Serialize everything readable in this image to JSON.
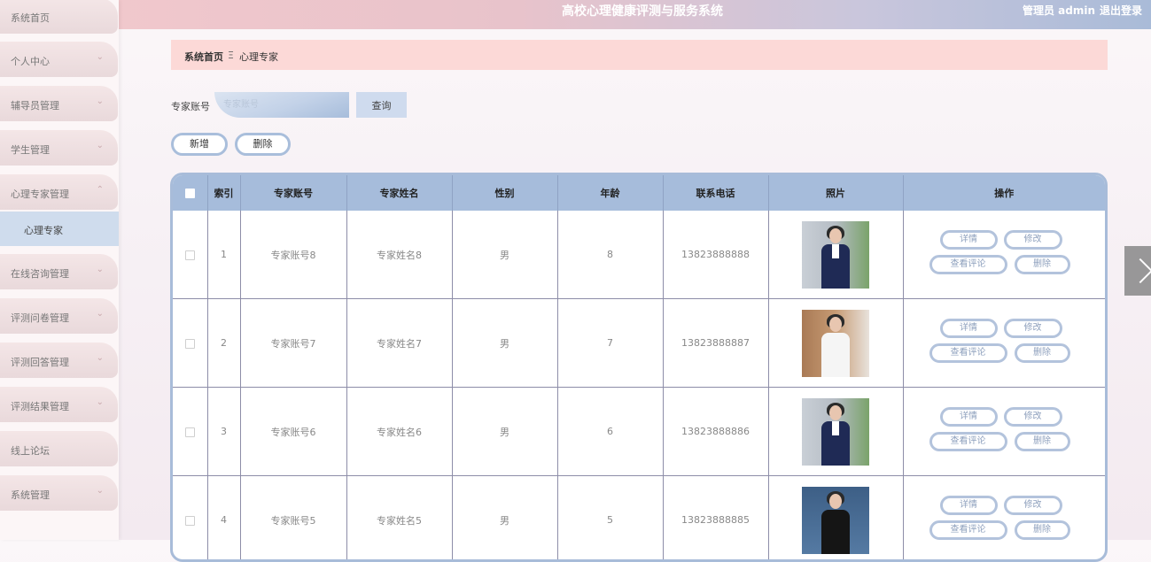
{
  "app": {
    "title": "高校心理健康评测与服务系统",
    "user": "管理员 admin",
    "logout": "退出登录"
  },
  "sidebar": {
    "items": [
      {
        "label": "系统首页",
        "expandable": false
      },
      {
        "label": "个人中心",
        "expandable": true
      },
      {
        "label": "辅导员管理",
        "expandable": true
      },
      {
        "label": "学生管理",
        "expandable": true
      },
      {
        "label": "心理专家管理",
        "expandable": true,
        "expanded": true
      },
      {
        "label": "在线咨询管理",
        "expandable": true
      },
      {
        "label": "评测问卷管理",
        "expandable": true
      },
      {
        "label": "评测回答管理",
        "expandable": true
      },
      {
        "label": "评测结果管理",
        "expandable": true
      },
      {
        "label": "线上论坛",
        "expandable": false
      },
      {
        "label": "系统管理",
        "expandable": true
      }
    ],
    "sub_item": {
      "label": "心理专家",
      "active": true
    }
  },
  "breadcrumb": {
    "home": "系统首页",
    "separator": "Ξ",
    "current": "心理专家"
  },
  "search": {
    "label": "专家账号",
    "placeholder": "专家账号",
    "button": "查询"
  },
  "actions": {
    "add": "新增",
    "delete": "删除"
  },
  "table": {
    "columns": [
      "",
      "索引",
      "专家账号",
      "专家姓名",
      "性别",
      "年龄",
      "联系电话",
      "照片",
      "操作"
    ],
    "rows": [
      {
        "index": "1",
        "account": "专家账号8",
        "name": "专家姓名8",
        "gender": "男",
        "age": "8",
        "phone": "13823888888",
        "photo": "photo-woman-navy-suit"
      },
      {
        "index": "2",
        "account": "专家账号7",
        "name": "专家姓名7",
        "gender": "男",
        "age": "7",
        "phone": "13823888887",
        "photo": "photo-woman-white-blouse"
      },
      {
        "index": "3",
        "account": "专家账号6",
        "name": "专家姓名6",
        "gender": "男",
        "age": "6",
        "phone": "13823888886",
        "photo": "photo-woman-navy-suit"
      },
      {
        "index": "4",
        "account": "专家账号5",
        "name": "专家姓名5",
        "gender": "男",
        "age": "5",
        "phone": "13823888885",
        "photo": "photo-woman-black-shirt"
      }
    ],
    "row_actions": {
      "detail": "详情",
      "edit": "修改",
      "comments": "查看评论",
      "delete": "删除"
    }
  },
  "colors": {
    "topbar_left": "#f3c9cc",
    "topbar_right": "#a9bbd8",
    "breadcrumb_bg": "#fcd9d7",
    "table_header": "#a6bcdb",
    "accent_border": "#a9bedb"
  }
}
